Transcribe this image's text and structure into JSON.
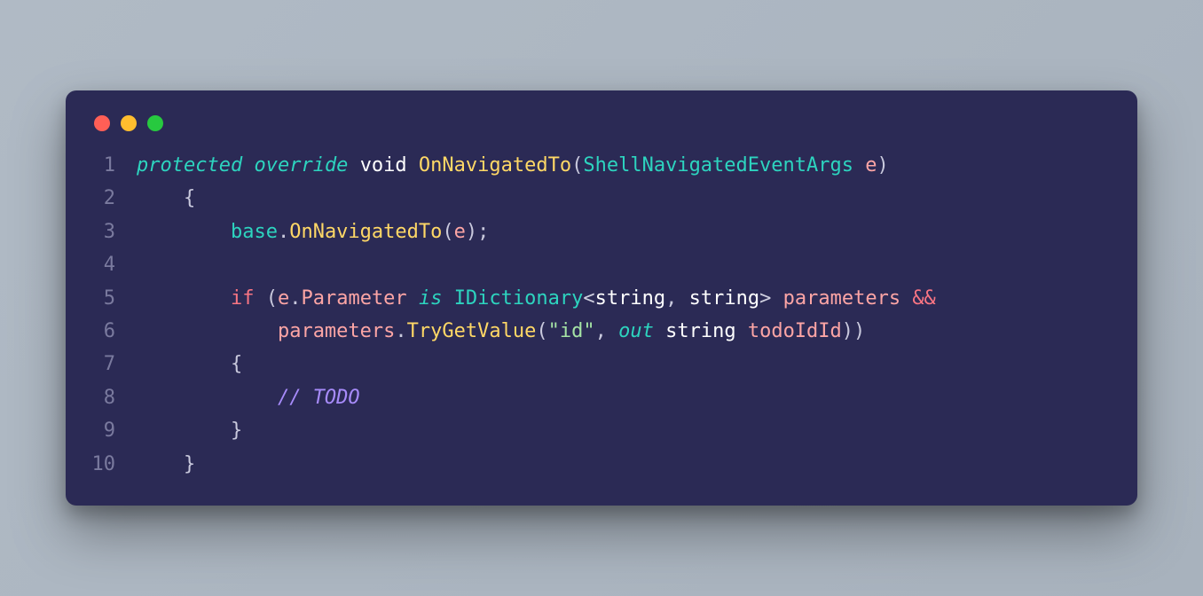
{
  "lines": [
    {
      "n": "1",
      "tokens": [
        {
          "cls": "kw-mod",
          "t": "protected"
        },
        {
          "cls": "punct",
          "t": " "
        },
        {
          "cls": "kw-mod",
          "t": "override"
        },
        {
          "cls": "punct",
          "t": " "
        },
        {
          "cls": "kw-type",
          "t": "void"
        },
        {
          "cls": "punct",
          "t": " "
        },
        {
          "cls": "fn",
          "t": "OnNavigatedTo"
        },
        {
          "cls": "punct",
          "t": "("
        },
        {
          "cls": "cls",
          "t": "ShellNavigatedEventArgs"
        },
        {
          "cls": "punct",
          "t": " "
        },
        {
          "cls": "param",
          "t": "e"
        },
        {
          "cls": "punct",
          "t": ")"
        }
      ]
    },
    {
      "n": "2",
      "tokens": [
        {
          "cls": "punct",
          "t": "    {"
        }
      ]
    },
    {
      "n": "3",
      "tokens": [
        {
          "cls": "punct",
          "t": "        "
        },
        {
          "cls": "obj",
          "t": "base"
        },
        {
          "cls": "punct",
          "t": "."
        },
        {
          "cls": "fn",
          "t": "OnNavigatedTo"
        },
        {
          "cls": "punct",
          "t": "("
        },
        {
          "cls": "param",
          "t": "e"
        },
        {
          "cls": "punct",
          "t": ");"
        }
      ]
    },
    {
      "n": "4",
      "tokens": [
        {
          "cls": "punct",
          "t": ""
        }
      ]
    },
    {
      "n": "5",
      "tokens": [
        {
          "cls": "punct",
          "t": "        "
        },
        {
          "cls": "kw-ctrl",
          "t": "if"
        },
        {
          "cls": "punct",
          "t": " ("
        },
        {
          "cls": "param",
          "t": "e"
        },
        {
          "cls": "punct",
          "t": "."
        },
        {
          "cls": "member",
          "t": "Parameter"
        },
        {
          "cls": "punct",
          "t": " "
        },
        {
          "cls": "kw-is",
          "t": "is"
        },
        {
          "cls": "punct",
          "t": " "
        },
        {
          "cls": "cls",
          "t": "IDictionary"
        },
        {
          "cls": "angle",
          "t": "<"
        },
        {
          "cls": "kw-type",
          "t": "string"
        },
        {
          "cls": "punct",
          "t": ", "
        },
        {
          "cls": "kw-type",
          "t": "string"
        },
        {
          "cls": "angle",
          "t": ">"
        },
        {
          "cls": "punct",
          "t": " "
        },
        {
          "cls": "param",
          "t": "parameters"
        },
        {
          "cls": "punct",
          "t": " "
        },
        {
          "cls": "kw-op",
          "t": "&&"
        }
      ]
    },
    {
      "n": "6",
      "tokens": [
        {
          "cls": "punct",
          "t": "            "
        },
        {
          "cls": "param",
          "t": "parameters"
        },
        {
          "cls": "punct",
          "t": "."
        },
        {
          "cls": "fn",
          "t": "TryGetValue"
        },
        {
          "cls": "punct",
          "t": "("
        },
        {
          "cls": "str",
          "t": "\"id\""
        },
        {
          "cls": "punct",
          "t": ", "
        },
        {
          "cls": "kw-is",
          "t": "out"
        },
        {
          "cls": "punct",
          "t": " "
        },
        {
          "cls": "kw-type",
          "t": "string"
        },
        {
          "cls": "punct",
          "t": " "
        },
        {
          "cls": "param",
          "t": "todoIdId"
        },
        {
          "cls": "punct",
          "t": "))"
        }
      ]
    },
    {
      "n": "7",
      "tokens": [
        {
          "cls": "punct",
          "t": "        {"
        }
      ]
    },
    {
      "n": "8",
      "tokens": [
        {
          "cls": "punct",
          "t": "            "
        },
        {
          "cls": "comment",
          "t": "// TODO"
        }
      ]
    },
    {
      "n": "9",
      "tokens": [
        {
          "cls": "punct",
          "t": "        }"
        }
      ]
    },
    {
      "n": "10",
      "tokens": [
        {
          "cls": "punct",
          "t": "    }"
        }
      ]
    }
  ]
}
